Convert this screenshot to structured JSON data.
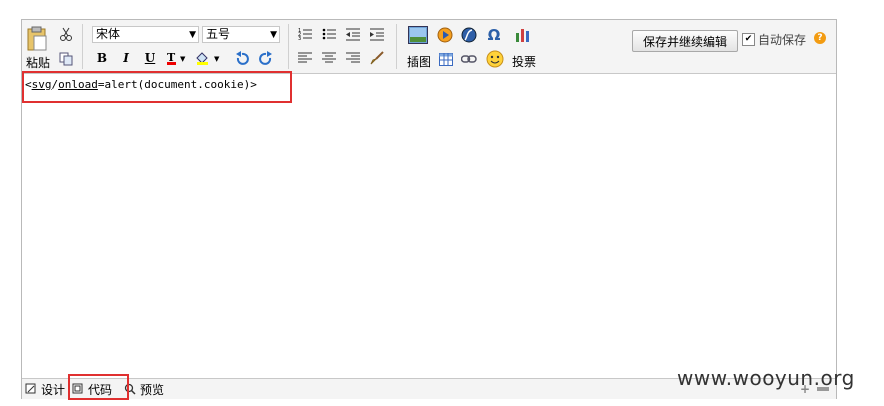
{
  "toolbar": {
    "paste_label": "粘贴",
    "font_family": "宋体",
    "font_size": "五号",
    "insert_image_label": "插图",
    "vote_label": "投票",
    "save_continue_label": "保存并继续编辑",
    "autosave_label": "自动保存",
    "help_glyph": "?",
    "bold": "B",
    "italic": "I",
    "underline": "U"
  },
  "content": {
    "code_part1": "<",
    "code_svg": "svg",
    "code_slash": "/",
    "code_onload": "onload",
    "code_rest": "=alert(document.cookie)>"
  },
  "statusbar": {
    "design_label": "设计",
    "code_label": "代码",
    "preview_label": "预览"
  },
  "watermark": "www.wooyun.org",
  "colors": {
    "highlight": "#e03030",
    "accent_help": "#f39c12"
  }
}
